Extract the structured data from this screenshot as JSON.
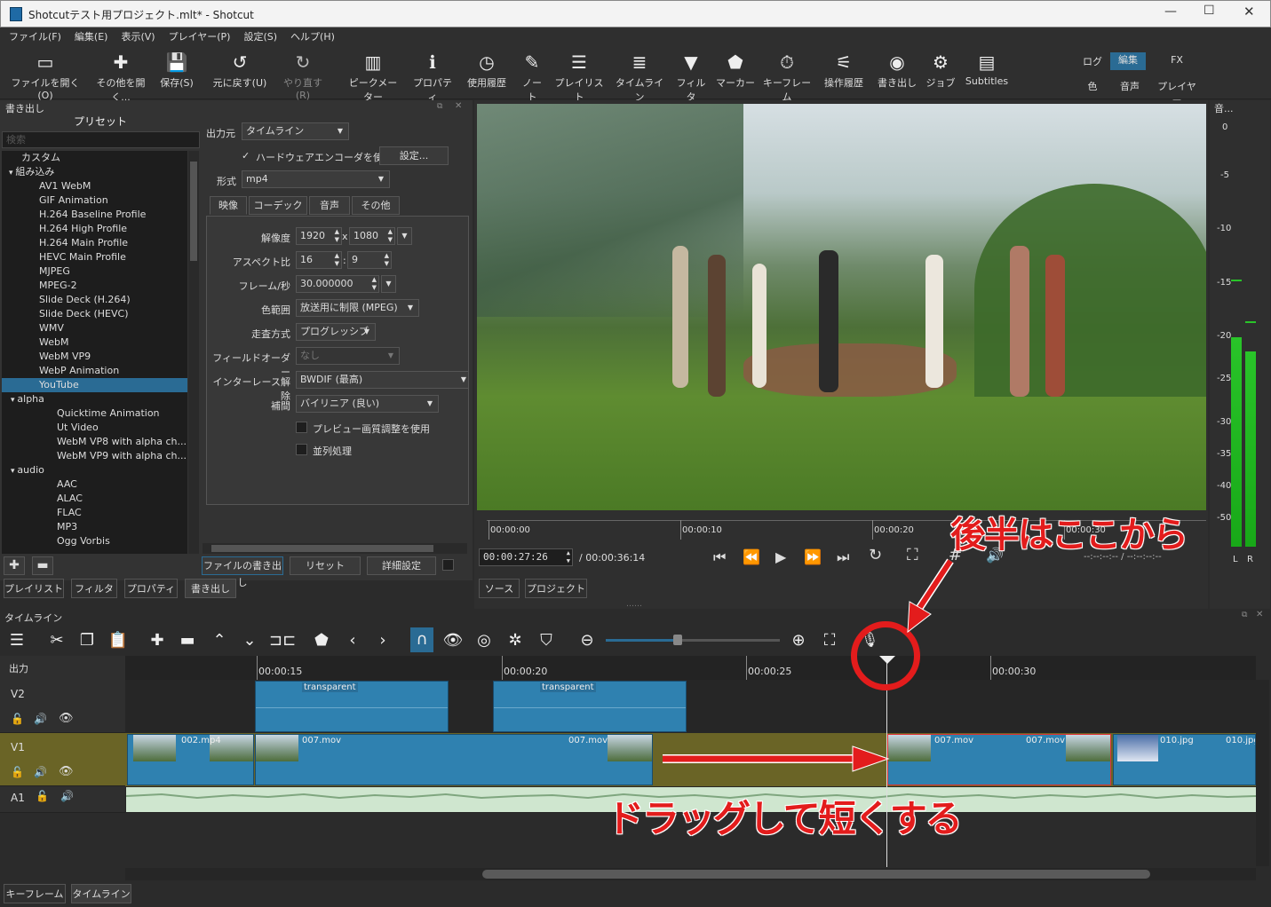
{
  "window": {
    "title": "Shotcutテスト用プロジェクト.mlt* - Shotcut"
  },
  "menu": [
    "ファイル(F)",
    "編集(E)",
    "表示(V)",
    "プレイヤー(P)",
    "設定(S)",
    "ヘルプ(H)"
  ],
  "toolbar": [
    {
      "label": "ファイルを開く(O)",
      "icon": "open-icon"
    },
    {
      "label": "その他を開く...",
      "icon": "open-other-icon"
    },
    {
      "label": "保存(S)",
      "icon": "save-icon"
    },
    {
      "label": "元に戻す(U)",
      "icon": "undo-icon"
    },
    {
      "label": "やり直す(R)",
      "icon": "redo-icon"
    },
    {
      "label": "ピークメーター",
      "icon": "peak-meter-icon"
    },
    {
      "label": "プロパティ",
      "icon": "properties-icon"
    },
    {
      "label": "使用履歴",
      "icon": "history-icon"
    },
    {
      "label": "ノート",
      "icon": "notes-icon"
    },
    {
      "label": "プレイリスト",
      "icon": "playlist-icon"
    },
    {
      "label": "タイムライン",
      "icon": "timeline-icon"
    },
    {
      "label": "フィルタ",
      "icon": "filter-icon"
    },
    {
      "label": "マーカー",
      "icon": "marker-icon"
    },
    {
      "label": "キーフレーム",
      "icon": "keyframe-icon"
    },
    {
      "label": "操作履歴",
      "icon": "action-history-icon"
    },
    {
      "label": "書き出し",
      "icon": "export-icon"
    },
    {
      "label": "ジョブ",
      "icon": "jobs-icon"
    },
    {
      "label": "Subtitles",
      "icon": "subtitles-icon"
    }
  ],
  "layouts": {
    "log": "ログ",
    "edit": "編集",
    "fx": "FX",
    "color": "色",
    "audio": "音声",
    "player": "プレイヤー"
  },
  "export": {
    "panel_title": "書き出し",
    "presets_title": "プリセット",
    "search_placeholder": "検索",
    "presets": [
      {
        "label": "カスタム",
        "level": 1
      },
      {
        "label": "組み込み",
        "level": 0
      },
      {
        "label": "AV1 WebM",
        "level": 2
      },
      {
        "label": "GIF Animation",
        "level": 2
      },
      {
        "label": "H.264 Baseline Profile",
        "level": 2
      },
      {
        "label": "H.264 High Profile",
        "level": 2
      },
      {
        "label": "H.264 Main Profile",
        "level": 2
      },
      {
        "label": "HEVC Main Profile",
        "level": 2
      },
      {
        "label": "MJPEG",
        "level": 2
      },
      {
        "label": "MPEG-2",
        "level": 2
      },
      {
        "label": "Slide Deck (H.264)",
        "level": 2
      },
      {
        "label": "Slide Deck (HEVC)",
        "level": 2
      },
      {
        "label": "WMV",
        "level": 2
      },
      {
        "label": "WebM",
        "level": 2
      },
      {
        "label": "WebM VP9",
        "level": 2
      },
      {
        "label": "WebP Animation",
        "level": 2
      },
      {
        "label": "YouTube",
        "level": 2,
        "selected": true
      },
      {
        "label": "alpha",
        "level": 1
      },
      {
        "label": "Quicktime Animation",
        "level": 3
      },
      {
        "label": "Ut Video",
        "level": 3
      },
      {
        "label": "WebM VP8 with alpha ch...",
        "level": 3
      },
      {
        "label": "WebM VP9 with alpha ch...",
        "level": 3
      },
      {
        "label": "audio",
        "level": 1
      },
      {
        "label": "AAC",
        "level": 3
      },
      {
        "label": "ALAC",
        "level": 3
      },
      {
        "label": "FLAC",
        "level": 3
      },
      {
        "label": "MP3",
        "level": 3
      },
      {
        "label": "Ogg Vorbis",
        "level": 3
      }
    ],
    "source_label": "出力元",
    "source_value": "タイムライン",
    "hw_encoder_label": "ハードウェアエンコーダを使用",
    "settings_button": "設定...",
    "format_label": "形式",
    "format_value": "mp4",
    "tabs": [
      "映像",
      "コーデック",
      "音声",
      "その他"
    ],
    "resolution_label": "解像度",
    "width": "1920",
    "height": "1080",
    "x_sep": "x",
    "aspect_label": "アスペクト比",
    "aspect_w": "16",
    "aspect_h": "9",
    "colon_sep": ":",
    "fps_label": "フレーム/秒",
    "fps_value": "30.000000",
    "color_range_label": "色範囲",
    "color_range_value": "放送用に制限 (MPEG)",
    "scan_label": "走査方式",
    "scan_value": "プログレッシブ",
    "field_order_label": "フィールドオーダー",
    "field_order_value": "なし",
    "deinterlace_label": "インターレース解除",
    "deinterlace_value": "BWDIF (最高)",
    "interp_label": "補間",
    "interp_value": "バイリニア (良い)",
    "preview_scale_label": "プレビュー画質調整を使用",
    "parallel_label": "並列処理",
    "export_file_button": "ファイルの書き出し",
    "reset_button": "リセット",
    "advanced_button": "詳細設定"
  },
  "left_tabs": [
    "プレイリスト",
    "フィルタ",
    "プロパティ",
    "書き出し"
  ],
  "player": {
    "ruler": [
      "00:00:00",
      "00:00:10",
      "00:00:20",
      "00:00:30"
    ],
    "position": "00:00:27:26",
    "duration": "/ 00:00:36:14",
    "in_out": "--:--:--:-- / --:--:--:--",
    "tabs": [
      "ソース",
      "プロジェクト"
    ]
  },
  "meter": {
    "title": "音...",
    "scale": [
      "0",
      "-5",
      "-10",
      "-15",
      "-20",
      "-25",
      "-30",
      "-35",
      "-40",
      "-50"
    ],
    "left": "L",
    "right": "R"
  },
  "timeline": {
    "title": "タイムライン",
    "output_label": "出力",
    "ruler": [
      "00:00:15",
      "00:00:20",
      "00:00:25",
      "00:00:30"
    ],
    "tracks": [
      {
        "name": "V2",
        "clips": [
          "transparent",
          "transparent"
        ]
      },
      {
        "name": "V1",
        "clips": [
          "002.mp4",
          "007.mov",
          "007.mov",
          "007.mov",
          "007.mov",
          "010.jpg",
          "010.jpg"
        ]
      },
      {
        "name": "A1",
        "clips": []
      }
    ]
  },
  "bottom_tabs": [
    "キーフレーム",
    "タイムライン"
  ],
  "annotations": {
    "top": "後半はここから",
    "bottom": "ドラッグして短くする"
  }
}
